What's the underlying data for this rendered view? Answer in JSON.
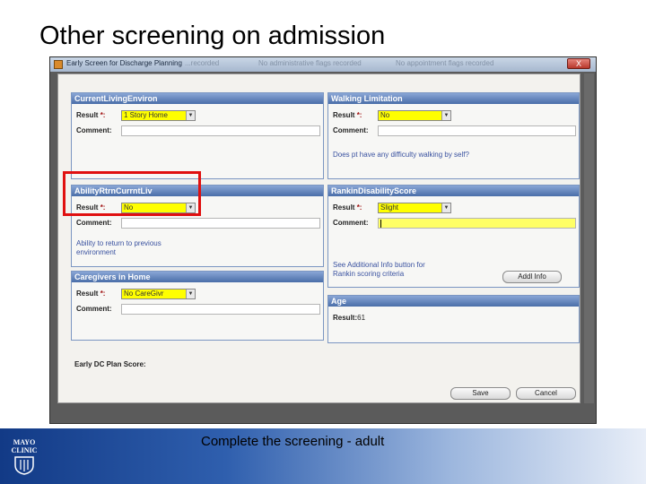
{
  "slide": {
    "title": "Other screening on admission",
    "footer": "Complete the screening - adult",
    "logo_text_top": "MAYO",
    "logo_text_bottom": "CLINIC"
  },
  "window": {
    "title": "Early Screen for Discharge Planning",
    "close_label": "X",
    "background_titles": [
      "...recorded",
      "No administrative flags recorded",
      "No appointment flags recorded"
    ]
  },
  "current_living": {
    "header": "CurrentLivingEnviron",
    "result_label": "Result",
    "req": "*:",
    "result_value": "1 Story Home",
    "comment_label": "Comment:"
  },
  "walking": {
    "header": "Walking Limitation",
    "result_label": "Result",
    "req": "*:",
    "result_value": "No",
    "comment_label": "Comment:",
    "note": "Does pt have any difficulty walking by self?"
  },
  "ability": {
    "header": "AbilityRtrnCurrntLiv",
    "result_label": "Result",
    "req": "*:",
    "result_value": "No",
    "comment_label": "Comment:",
    "note_line1": "Ability to return to previous",
    "note_line2": "environment"
  },
  "rankin": {
    "header": "RankinDisabilityScore",
    "result_label": "Result",
    "req": "*:",
    "result_value": "Slight",
    "comment_label": "Comment:",
    "note_line1": "See Additional Info button for",
    "note_line2": "Rankin scoring criteria",
    "button": "Addl Info"
  },
  "caregivers": {
    "header": "Caregivers in Home",
    "result_label": "Result",
    "req": "*:",
    "result_value": "No CareGivr",
    "comment_label": "Comment:"
  },
  "age": {
    "header": "Age",
    "result_label": "Result:",
    "result_value": "61"
  },
  "bottom": {
    "plan_label": "Early DC Plan Score:",
    "save": "Save",
    "cancel": "Cancel"
  },
  "colors": {
    "required_field": "#ffff00",
    "group_header": "#4a6ea8",
    "highlight": "#e01010"
  }
}
